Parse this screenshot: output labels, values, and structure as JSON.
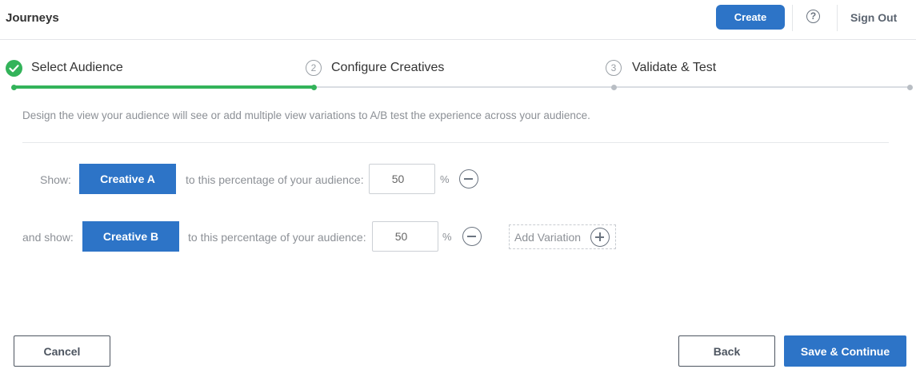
{
  "header": {
    "title": "Journeys",
    "create_label": "Create",
    "help_glyph": "?",
    "signout_label": "Sign Out"
  },
  "steps": [
    {
      "number": "1",
      "label": "Select Audience",
      "status": "complete"
    },
    {
      "number": "2",
      "label": "Configure Creatives",
      "status": "current"
    },
    {
      "number": "3",
      "label": "Validate & Test",
      "status": "pending"
    }
  ],
  "description": "Design the view your audience will see or add multiple view variations to A/B test the experience across your audience.",
  "variations": [
    {
      "prefix": "Show:",
      "creative": "Creative A",
      "percent_label": "to this percentage of your audience:",
      "percent": "50",
      "percent_sign": "%"
    },
    {
      "prefix": "and show:",
      "creative": "Creative B",
      "percent_label": "to this percentage of your audience:",
      "percent": "50",
      "percent_sign": "%"
    }
  ],
  "add_variation_label": "Add Variation",
  "footer": {
    "cancel_label": "Cancel",
    "back_label": "Back",
    "save_label": "Save & Continue"
  },
  "colors": {
    "primary": "#2d74c7",
    "success": "#33b35a",
    "track": "#d9dde2",
    "muted_text": "#8c9096"
  },
  "icons": {
    "step1": "check-circle-icon",
    "help": "question-circle-icon",
    "remove": "minus-circle-icon",
    "add": "plus-circle-icon"
  }
}
